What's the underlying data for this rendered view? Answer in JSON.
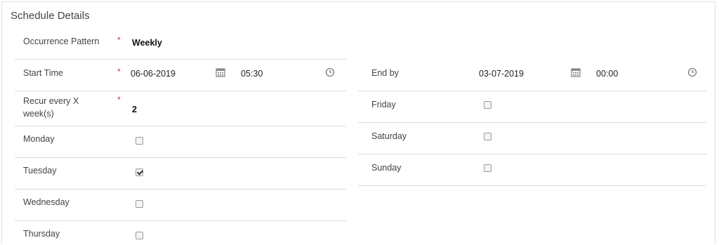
{
  "section": {
    "title": "Schedule Details"
  },
  "left": {
    "occurrence": {
      "label": "Occurrence Pattern",
      "required": "*",
      "value": "Weekly"
    },
    "start": {
      "label": "Start Time",
      "required": "*",
      "date": "06-06-2019",
      "time": "05:30"
    },
    "recur": {
      "label_line1": "Recur every X",
      "label_line2": "week(s)",
      "required": "*",
      "value": "2"
    },
    "days": [
      {
        "label": "Monday",
        "checked": false
      },
      {
        "label": "Tuesday",
        "checked": true
      },
      {
        "label": "Wednesday",
        "checked": false
      },
      {
        "label": "Thursday",
        "checked": false
      }
    ]
  },
  "right": {
    "end": {
      "label": "End by",
      "date": "03-07-2019",
      "time": "00:00"
    },
    "days": [
      {
        "label": "Friday",
        "checked": false
      },
      {
        "label": "Saturday",
        "checked": false
      },
      {
        "label": "Sunday",
        "checked": false
      }
    ]
  },
  "icons": {
    "calendar": "calendar-icon",
    "clock": "clock-icon"
  }
}
